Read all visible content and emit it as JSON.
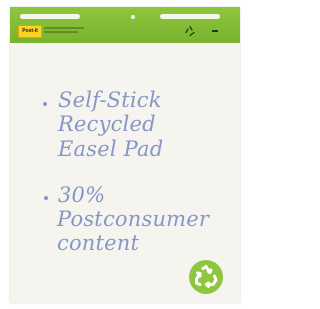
{
  "header": {
    "logo_text": "Post-it",
    "header_icon": "recycle-icon",
    "accent_color": "#8ec63f"
  },
  "notes": {
    "line1": "Self-Stick",
    "line2": "Recycled",
    "line3": "Easel Pad",
    "line4": "30%",
    "line5": "Postconsumer",
    "line6": "content"
  },
  "badge": {
    "icon": "recycle-icon",
    "color": "#8ec63f"
  },
  "handwriting_color": "#8796c7"
}
